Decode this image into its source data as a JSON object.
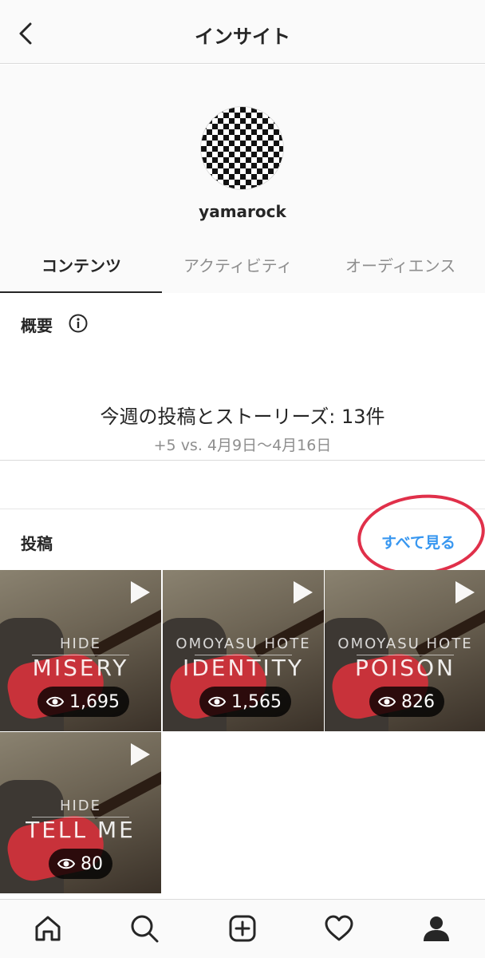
{
  "header": {
    "title": "インサイト"
  },
  "profile": {
    "username": "yamarock"
  },
  "tabs": [
    {
      "label": "コンテンツ",
      "active": true
    },
    {
      "label": "アクティビティ",
      "active": false
    },
    {
      "label": "オーディエンス",
      "active": false
    }
  ],
  "overview": {
    "title": "概要",
    "summary": "今週の投稿とストーリーズ: 13件",
    "comparison": "+5 vs. 4月9日〜4月16日"
  },
  "posts": {
    "title": "投稿",
    "see_all": "すべて見る",
    "items": [
      {
        "artist": "HIDE",
        "song": "MISERY",
        "views": "1,695"
      },
      {
        "artist": "OMOYASU HOTE",
        "song": "IDENTITY",
        "views": "1,565"
      },
      {
        "artist": "OMOYASU HOTE",
        "song": "POISON",
        "views": "826"
      },
      {
        "artist": "HIDE",
        "song": "TELL ME",
        "views": "80"
      }
    ]
  },
  "bottom_nav": [
    "home-icon",
    "search-icon",
    "add-post-icon",
    "activity-heart-icon",
    "profile-icon"
  ],
  "colors": {
    "link": "#3897f0",
    "highlight_circle": "#e0304a",
    "text": "#262626",
    "muted": "#8e8e8e"
  }
}
